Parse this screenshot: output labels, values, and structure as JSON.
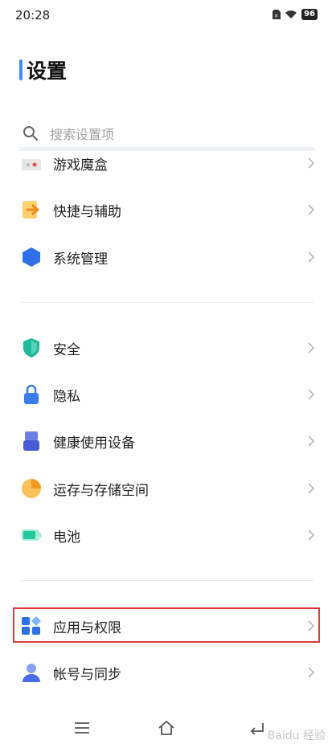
{
  "status": {
    "time": "20:28",
    "battery": "96"
  },
  "page": {
    "title": "设置"
  },
  "search": {
    "placeholder": "搜索设置项"
  },
  "groups": [
    [
      {
        "label": "游戏魔盒",
        "icon": "game-box-icon"
      },
      {
        "label": "快捷与辅助",
        "icon": "shortcut-arrow-icon"
      },
      {
        "label": "系统管理",
        "icon": "hexagon-icon"
      }
    ],
    [
      {
        "label": "安全",
        "icon": "shield-icon"
      },
      {
        "label": "隐私",
        "icon": "lock-icon"
      },
      {
        "label": "健康使用设备",
        "icon": "hourglass-icon"
      },
      {
        "label": "运存与存储空间",
        "icon": "pie-chart-icon"
      },
      {
        "label": "电池",
        "icon": "battery-icon"
      }
    ],
    [
      {
        "label": "应用与权限",
        "icon": "apps-grid-icon"
      },
      {
        "label": "帐号与同步",
        "icon": "person-icon"
      }
    ]
  ],
  "watermark": "Baidu 经验"
}
